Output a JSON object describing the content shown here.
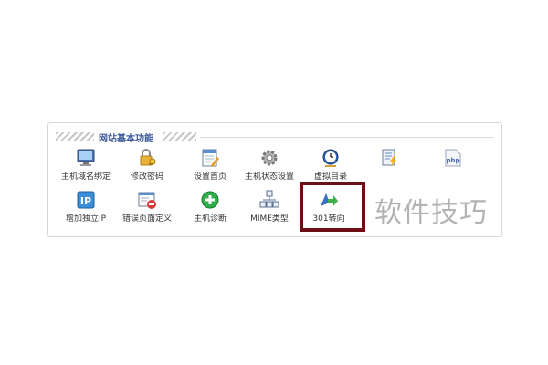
{
  "panel": {
    "title": "网站基本功能",
    "items": [
      {
        "label": "主机域名绑定",
        "icon": "monitor-icon"
      },
      {
        "label": "修改密码",
        "icon": "key-lock-icon"
      },
      {
        "label": "设置首页",
        "icon": "page-edit-icon"
      },
      {
        "label": "主机状态设置",
        "icon": "gear-icon"
      },
      {
        "label": "虚拟目录",
        "icon": "clock-icon"
      },
      {
        "label": "",
        "icon": "document-lightning-icon"
      },
      {
        "label": "",
        "icon": "php-icon"
      },
      {
        "label": "增加独立IP",
        "icon": "ip-icon"
      },
      {
        "label": "错误页面定义",
        "icon": "error-page-icon"
      },
      {
        "label": "主机诊断",
        "icon": "plus-circle-icon"
      },
      {
        "label": "MIME类型",
        "icon": "file-tree-icon"
      },
      {
        "label": "301转向",
        "icon": "redirect-arrow-icon"
      }
    ],
    "icon_texts": {
      "ip": "IP",
      "php": "php"
    }
  },
  "watermark": "软件技巧",
  "colors": {
    "highlight_border": "#6b1015",
    "title": "#3b5998"
  }
}
